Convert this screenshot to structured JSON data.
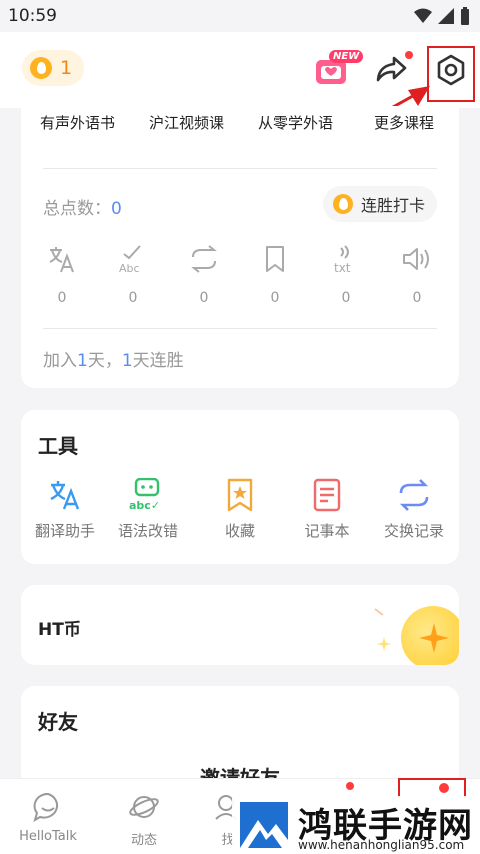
{
  "status_bar": {
    "time": "10:59"
  },
  "header": {
    "coin_count": "1",
    "new_badge": "NEW"
  },
  "courses": {
    "tabs": [
      "有声外语书",
      "沪江视频课",
      "从零学外语",
      "更多课程"
    ]
  },
  "points": {
    "label": "总点数：",
    "value": "0",
    "checkin_label": "连胜打卡"
  },
  "stats": [
    {
      "icon": "translate-icon",
      "value": "0"
    },
    {
      "icon": "grammar-icon",
      "value": "0"
    },
    {
      "icon": "transliterate-icon",
      "value": "0"
    },
    {
      "icon": "bookmark-icon",
      "value": "0"
    },
    {
      "icon": "txt-voice-icon",
      "value": "0"
    },
    {
      "icon": "speaker-icon",
      "value": "0"
    }
  ],
  "streak": {
    "prefix": "加入",
    "days_joined": "1",
    "mid": "天，",
    "streak_days": "1",
    "suffix": "天连胜"
  },
  "tools": {
    "title": "工具",
    "items": [
      {
        "label": "翻译助手",
        "icon": "translate-icon",
        "color": "#3a9af0"
      },
      {
        "label": "语法改错",
        "icon": "grammar-check-icon",
        "color": "#33c26b"
      },
      {
        "label": "收藏",
        "icon": "bookmark-star-icon",
        "color": "#f2a93b"
      },
      {
        "label": "记事本",
        "icon": "notebook-icon",
        "color": "#f06a6a"
      },
      {
        "label": "交换记录",
        "icon": "exchange-icon",
        "color": "#6b8cf5"
      }
    ]
  },
  "ht_coin": {
    "label": "HT币"
  },
  "friends": {
    "title": "好友",
    "invite_label": "邀请好友"
  },
  "bottom_nav": [
    {
      "label": "HelloTalk",
      "icon": "chat-icon"
    },
    {
      "label": "动态",
      "icon": "planet-icon"
    },
    {
      "label": "找",
      "icon": "search-people-icon"
    }
  ],
  "watermark": {
    "title": "鸿联手游网",
    "url": "www.henanhonglian95.com"
  },
  "colors": {
    "accent_blue": "#5b8def",
    "coin_orange": "#ffb21f",
    "highlight_red": "#e02020"
  }
}
